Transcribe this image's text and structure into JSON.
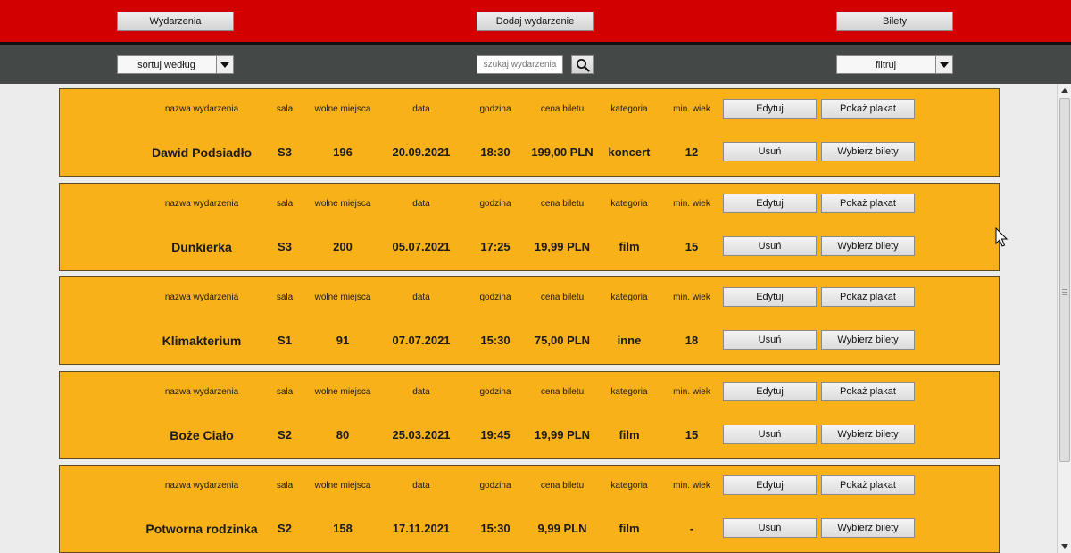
{
  "nav": {
    "events_label": "Wydarzenia",
    "add_event_label": "Dodaj wydarzenie",
    "tickets_label": "Bilety"
  },
  "toolbar": {
    "sort_label": "sortuj według",
    "search_placeholder": "szukaj wydarzenia",
    "filter_label": "filtruj"
  },
  "columns": {
    "name": "nazwa wydarzenia",
    "room": "sala",
    "seats": "wolne miejsca",
    "date": "data",
    "time": "godzina",
    "price": "cena biletu",
    "category": "kategoria",
    "min_age": "min. wiek"
  },
  "actions": {
    "edit": "Edytuj",
    "show_poster": "Pokaż plakat",
    "delete": "Usuń",
    "choose_tickets": "Wybierz bilety"
  },
  "events": [
    {
      "name": "Dawid Podsiadło",
      "room": "S3",
      "seats": "196",
      "date": "20.09.2021",
      "time": "18:30",
      "price": "199,00 PLN",
      "category": "koncert",
      "min_age": "12"
    },
    {
      "name": "Dunkierka",
      "room": "S3",
      "seats": "200",
      "date": "05.07.2021",
      "time": "17:25",
      "price": "19,99 PLN",
      "category": "film",
      "min_age": "15"
    },
    {
      "name": "Klimakterium",
      "room": "S1",
      "seats": "91",
      "date": "07.07.2021",
      "time": "15:30",
      "price": "75,00 PLN",
      "category": "inne",
      "min_age": "18"
    },
    {
      "name": "Boże Ciało",
      "room": "S2",
      "seats": "80",
      "date": "25.03.2021",
      "time": "19:45",
      "price": "19,99 PLN",
      "category": "film",
      "min_age": "15"
    },
    {
      "name": "Potworna rodzinka",
      "room": "S2",
      "seats": "158",
      "date": "17.11.2021",
      "time": "15:30",
      "price": "9,99 PLN",
      "category": "film",
      "min_age": "-"
    }
  ],
  "colors": {
    "topbar": "#d20000",
    "toolbar": "#444847",
    "card": "#f9b11a"
  },
  "icons": {
    "search": "search-icon",
    "dropdown": "chevron-down-icon"
  }
}
